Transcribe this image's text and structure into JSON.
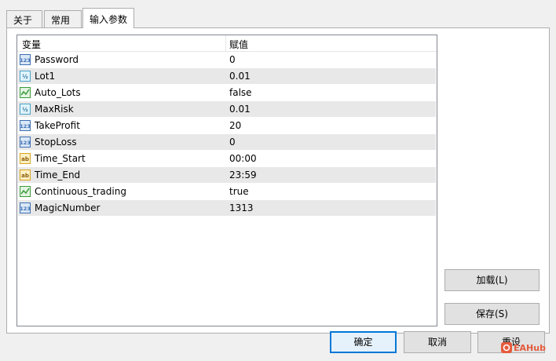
{
  "tabs": [
    {
      "label": "关于"
    },
    {
      "label": "常用"
    },
    {
      "label": "输入参数"
    }
  ],
  "table": {
    "headers": [
      "变量",
      "赋值"
    ],
    "rows": [
      {
        "name": "Password",
        "value": "0",
        "icon": "integer-icon"
      },
      {
        "name": "Lot1",
        "value": "0.01",
        "icon": "double-icon"
      },
      {
        "name": "Auto_Lots",
        "value": "false",
        "icon": "bool-icon"
      },
      {
        "name": "MaxRisk",
        "value": "0.01",
        "icon": "double-icon"
      },
      {
        "name": "TakeProfit",
        "value": "20",
        "icon": "integer-icon"
      },
      {
        "name": "StopLoss",
        "value": "0",
        "icon": "integer-icon"
      },
      {
        "name": "Time_Start",
        "value": "00:00",
        "icon": "string-icon"
      },
      {
        "name": "Time_End",
        "value": "23:59",
        "icon": "string-icon"
      },
      {
        "name": "Continuous_trading",
        "value": "true",
        "icon": "bool-icon"
      },
      {
        "name": "MagicNumber",
        "value": "1313",
        "icon": "integer-icon"
      }
    ]
  },
  "buttons": {
    "load": "加载(L)",
    "save": "保存(S)",
    "ok": "确定",
    "cancel": "取消",
    "reset": "重设"
  },
  "watermark": "EAHub",
  "colors": {
    "integer_icon": "#3c6fb4",
    "double_icon": "#4aa3c9",
    "bool_icon": "#3a9a3a",
    "string_icon": "#d9a520",
    "watermark": "#e55b3c"
  }
}
